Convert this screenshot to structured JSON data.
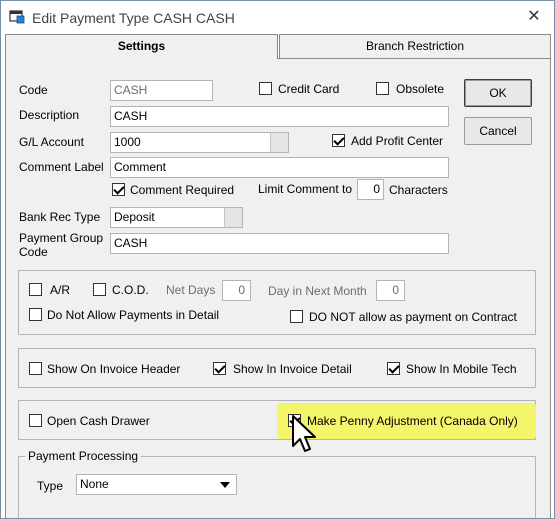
{
  "window": {
    "title": "Edit Payment Type CASH CASH",
    "close_glyph": "✕"
  },
  "tabs": [
    {
      "label": "Settings",
      "active": true
    },
    {
      "label": "Branch Restriction",
      "active": false
    }
  ],
  "buttons": {
    "ok": "OK",
    "cancel": "Cancel"
  },
  "fields": {
    "code": {
      "label": "Code",
      "value": "CASH"
    },
    "description": {
      "label": "Description",
      "value": "CASH"
    },
    "gl_account": {
      "label": "G/L Account",
      "value": "1000"
    },
    "comment_label": {
      "label": "Comment Label",
      "value": "Comment"
    },
    "bank_rec_type": {
      "label": "Bank Rec Type",
      "value": "Deposit"
    },
    "payment_group_code": {
      "label_line1": "Payment Group",
      "label_line2": "Code",
      "value": "CASH"
    }
  },
  "checkboxes": {
    "credit_card": {
      "label": "Credit Card",
      "checked": false
    },
    "obsolete": {
      "label": "Obsolete",
      "checked": false
    },
    "add_profit_center": {
      "label": "Add Profit Center",
      "checked": true
    },
    "comment_required": {
      "label": "Comment Required",
      "checked": true
    },
    "ar": {
      "label": "A/R",
      "checked": false
    },
    "cod": {
      "label": "C.O.D.",
      "checked": false
    },
    "no_payments_in_detail": {
      "label": "Do Not Allow Payments in Detail",
      "checked": false
    },
    "not_payment_on_contract": {
      "label": "DO NOT allow as payment on Contract",
      "checked": false
    },
    "show_on_invoice_header": {
      "label": "Show On Invoice Header",
      "checked": false
    },
    "show_in_invoice_detail": {
      "label": "Show In Invoice Detail",
      "checked": true
    },
    "show_in_mobile_tech": {
      "label": "Show In Mobile Tech",
      "checked": true
    },
    "open_cash_drawer": {
      "label": "Open Cash Drawer",
      "checked": false
    },
    "penny_adjustment": {
      "label": "Make Penny Adjustment (Canada Only)",
      "checked": true
    }
  },
  "limit_comment": {
    "label_before": "Limit Comment to",
    "value": "0",
    "label_after": "Characters"
  },
  "terms": {
    "net_days_label": "Net Days",
    "net_days_value": "0",
    "day_in_next_month_label": "Day in Next Month",
    "day_in_next_month_value": "0"
  },
  "payment_processing": {
    "group_label": "Payment Processing",
    "type_label": "Type",
    "type_value": "None"
  },
  "colors": {
    "highlight": "#f5f56b",
    "panel": "#f0f0f0"
  }
}
